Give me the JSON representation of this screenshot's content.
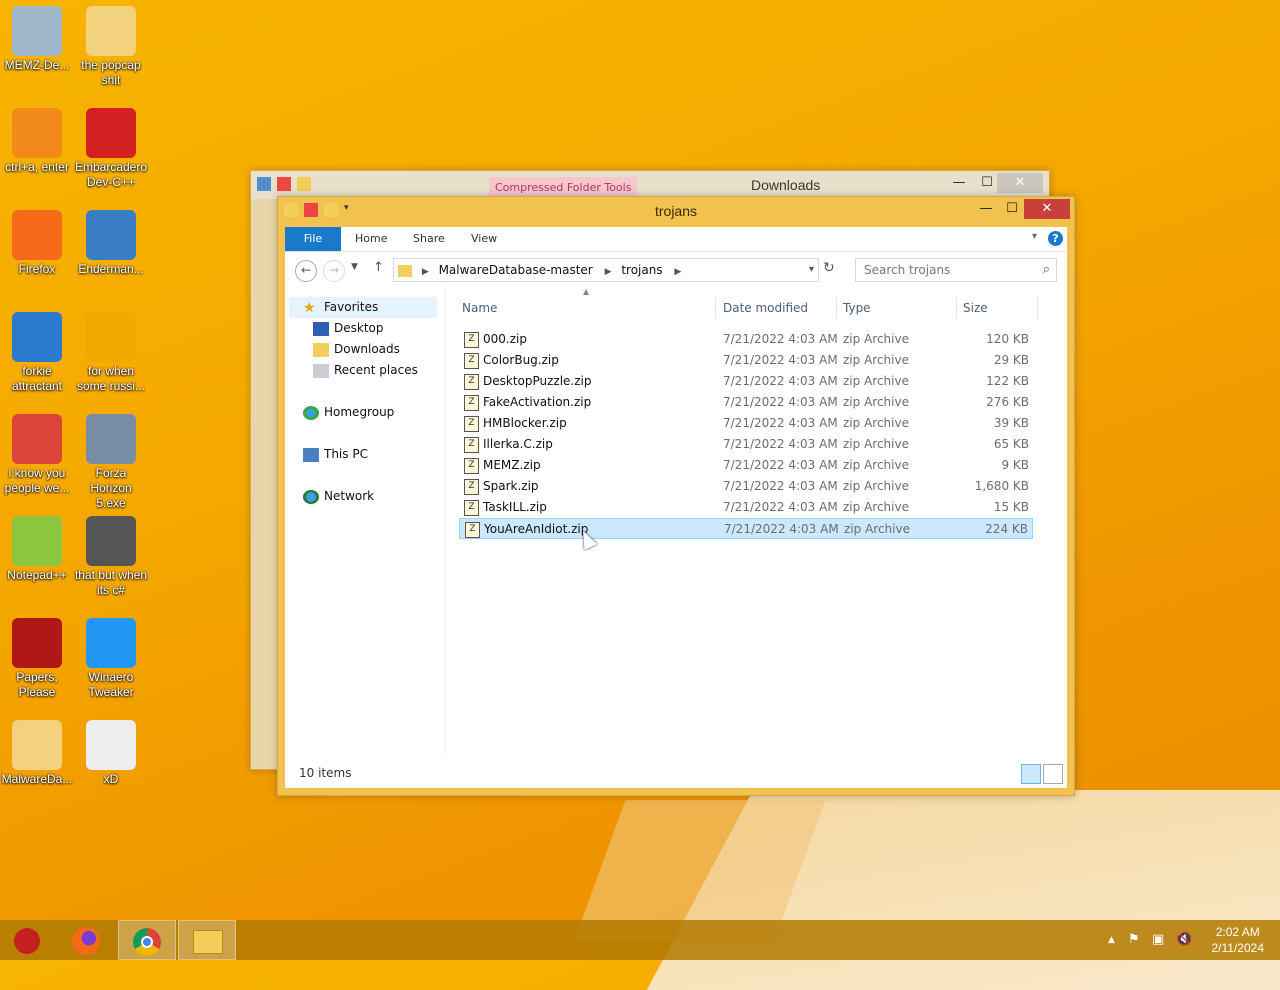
{
  "desktop_icons": [
    {
      "label": "MEMZ-De...",
      "icon": "recycle-bin-icon",
      "color": "#9fb7c9"
    },
    {
      "label": "the popcap shit",
      "icon": "folder-icon",
      "color": "#f2d27c"
    },
    {
      "label": "ctrl+a, enter",
      "icon": "search-magnifier-icon",
      "color": "#f28a1a"
    },
    {
      "label": "Embarcadero Dev-C++",
      "icon": "dev-cpp-icon",
      "color": "#d42020"
    },
    {
      "label": "Firefox",
      "icon": "firefox-icon",
      "color": "#f56a18"
    },
    {
      "label": "Enderman...",
      "icon": "window-app-icon",
      "color": "#3a7dc5"
    },
    {
      "label": "forkie attractant",
      "icon": "settings-monitor-icon",
      "color": "#2a7bd0"
    },
    {
      "label": "for when some russi...",
      "icon": "de-app-icon",
      "color": "#f2a800"
    },
    {
      "label": "i know you people we...",
      "icon": "chrome-icon",
      "color": "#db4437"
    },
    {
      "label": "Forza Horizon 5.exe",
      "icon": "flash-icon",
      "color": "#7a8da6"
    },
    {
      "label": "Notepad++",
      "icon": "notepad-plus-icon",
      "color": "#8cc63f"
    },
    {
      "label": "that but when its c#",
      "icon": "windows-stack-icon",
      "color": "#555555"
    },
    {
      "label": "Papers, Please",
      "icon": "papers-please-icon",
      "color": "#b01818"
    },
    {
      "label": "Winaero Tweaker",
      "icon": "winaero-icon",
      "color": "#2196f3"
    },
    {
      "label": "MalwareDa...",
      "icon": "folder-icon",
      "color": "#f2d27c"
    },
    {
      "label": "xD",
      "icon": "hxd-icon",
      "color": "#eeeeee"
    }
  ],
  "back_window": {
    "title": "Downloads",
    "context_tab": "Compressed Folder Tools"
  },
  "window": {
    "title": "trojans",
    "tabs": [
      "File",
      "Home",
      "Share",
      "View"
    ],
    "breadcrumb": [
      "MalwareDatabase-master",
      "trojans"
    ],
    "search_placeholder": "Search trojans",
    "nav": {
      "favorites": "Favorites",
      "desktop": "Desktop",
      "downloads": "Downloads",
      "recent": "Recent places",
      "homegroup": "Homegroup",
      "thispc": "This PC",
      "network": "Network"
    },
    "columns": {
      "name": "Name",
      "date": "Date modified",
      "type": "Type",
      "size": "Size"
    },
    "files": [
      {
        "name": "000.zip",
        "date": "7/21/2022 4:03 AM",
        "type": "zip Archive",
        "size": "120 KB"
      },
      {
        "name": "ColorBug.zip",
        "date": "7/21/2022 4:03 AM",
        "type": "zip Archive",
        "size": "29 KB"
      },
      {
        "name": "DesktopPuzzle.zip",
        "date": "7/21/2022 4:03 AM",
        "type": "zip Archive",
        "size": "122 KB"
      },
      {
        "name": "FakeActivation.zip",
        "date": "7/21/2022 4:03 AM",
        "type": "zip Archive",
        "size": "276 KB"
      },
      {
        "name": "HMBlocker.zip",
        "date": "7/21/2022 4:03 AM",
        "type": "zip Archive",
        "size": "39 KB"
      },
      {
        "name": "Illerka.C.zip",
        "date": "7/21/2022 4:03 AM",
        "type": "zip Archive",
        "size": "65 KB"
      },
      {
        "name": "MEMZ.zip",
        "date": "7/21/2022 4:03 AM",
        "type": "zip Archive",
        "size": "9 KB"
      },
      {
        "name": "Spark.zip",
        "date": "7/21/2022 4:03 AM",
        "type": "zip Archive",
        "size": "1,680 KB"
      },
      {
        "name": "TaskILL.zip",
        "date": "7/21/2022 4:03 AM",
        "type": "zip Archive",
        "size": "15 KB"
      },
      {
        "name": "YouAreAnIdiot.zip",
        "date": "7/21/2022 4:03 AM",
        "type": "zip Archive",
        "size": "224 KB",
        "selected": true
      }
    ],
    "status": "10 items"
  },
  "taskbar": {
    "time": "2:02 AM",
    "date": "2/11/2024"
  },
  "colors": {
    "accent": "#1979ca",
    "window_frame": "#f2c24f",
    "selection": "#cce8ff"
  }
}
